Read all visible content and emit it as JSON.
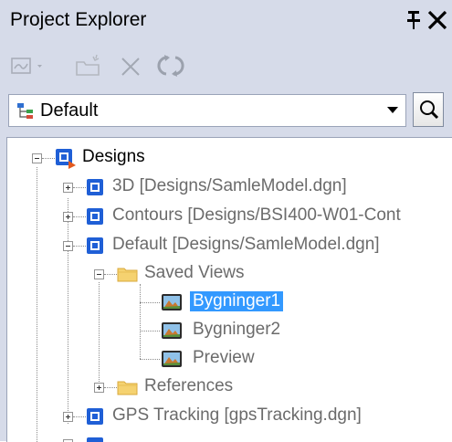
{
  "panel": {
    "title": "Project Explorer"
  },
  "combo": {
    "selected": "Default",
    "icon": "hierarchy-icon"
  },
  "tree": {
    "root": "Designs",
    "items": [
      "3D [Designs/SamleModel.dgn]",
      "Contours [Designs/BSI400-W01-Cont",
      "Default [Designs/SamleModel.dgn]",
      "GPS Tracking [gpsTracking.dgn]"
    ],
    "saved_views": "Saved Views",
    "views": [
      "Bygninger1",
      "Bygninger2",
      "Preview"
    ],
    "references": "References"
  },
  "colors": {
    "panel_bg": "#d6dbe9",
    "selection": "#3399ff",
    "design_icon": "#1f5fd6"
  }
}
